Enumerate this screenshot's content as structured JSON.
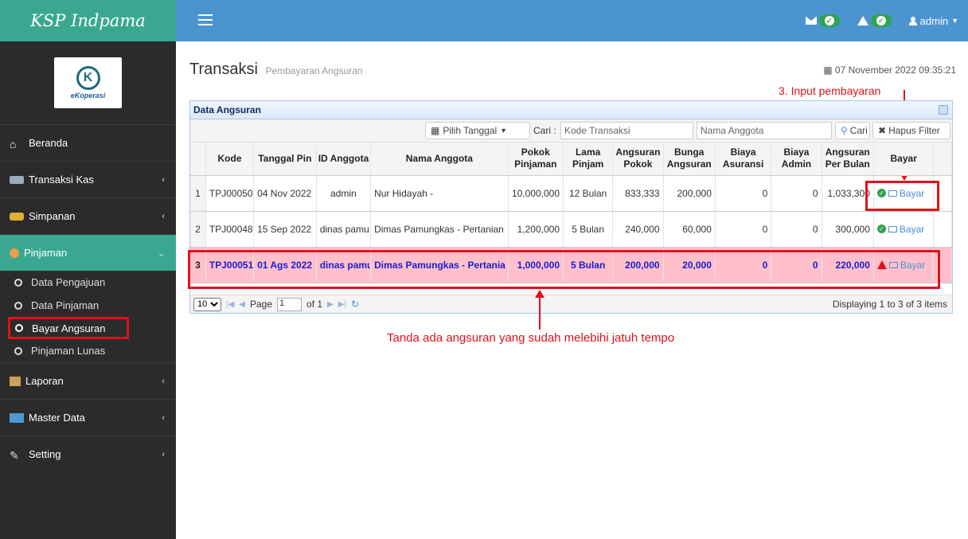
{
  "brand": "KSP Indpama",
  "top": {
    "user": "admin"
  },
  "logo": {
    "text": "eKoperasi"
  },
  "sidebar": {
    "items": [
      {
        "label": "Beranda"
      },
      {
        "label": "Transaksi Kas"
      },
      {
        "label": "Simpanan"
      },
      {
        "label": "Pinjaman"
      },
      {
        "label": "Laporan"
      },
      {
        "label": "Master Data"
      },
      {
        "label": "Setting"
      }
    ],
    "sub": [
      {
        "label": "Data Pengajuan"
      },
      {
        "label": "Data Pinjaman"
      },
      {
        "label": "Bayar Angsuran"
      },
      {
        "label": "Pinjaman Lunas"
      }
    ]
  },
  "page": {
    "title": "Transaksi",
    "subtitle": "Pembayaran Angsuran",
    "datetime": "07 November 2022  09:35:21"
  },
  "annotations": {
    "top": "3. Input pembayaran",
    "bottom": "Tanda ada angsuran yang sudah melebihi jatuh tempo"
  },
  "panel": {
    "title": "Data Angsuran",
    "date_filter": "Pilih Tanggal",
    "cari_label": "Cari :",
    "kode_placeholder": "Kode Transaksi",
    "nama_placeholder": "Nama Anggota",
    "cari_button": "Cari",
    "hapus_button": "Hapus Filter"
  },
  "table": {
    "headers": [
      "Kode",
      "Tanggal Pin",
      "ID Anggota",
      "Nama Anggota",
      "Pokok Pinjaman",
      "Lama Pinjam",
      "Angsuran Pokok",
      "Bunga Angsuran",
      "Biaya Asuransi",
      "Biaya Admin",
      "Angsuran Per Bulan",
      "Bayar"
    ],
    "rows": [
      {
        "no": "1",
        "kode": "TPJ00050",
        "tanggal": "04 Nov 2022",
        "id": "admin",
        "nama": "Nur Hidayah -",
        "pokok": "10,000,000",
        "lama": "12 Bulan",
        "angsuran_pokok": "833,333",
        "bunga": "200,000",
        "asuransi": "0",
        "admin": "0",
        "per_bulan": "1,033,300",
        "bayar": "Bayar"
      },
      {
        "no": "2",
        "kode": "TPJ00048",
        "tanggal": "15 Sep 2022",
        "id": "dinas pamu",
        "nama": "Dimas Pamungkas - Pertanian",
        "pokok": "1,200,000",
        "lama": "5 Bulan",
        "angsuran_pokok": "240,000",
        "bunga": "60,000",
        "asuransi": "0",
        "admin": "0",
        "per_bulan": "300,000",
        "bayar": "Bayar"
      },
      {
        "no": "3",
        "kode": "TPJ00051",
        "tanggal": "01 Ags 2022",
        "id": "dinas pamu",
        "nama": "Dimas Pamungkas - Pertania",
        "pokok": "1,000,000",
        "lama": "5 Bulan",
        "angsuran_pokok": "200,000",
        "bunga": "20,000",
        "asuransi": "0",
        "admin": "0",
        "per_bulan": "220,000",
        "bayar": "Bayar"
      }
    ]
  },
  "pager": {
    "page_size": "10",
    "page_label": "Page",
    "page_value": "1",
    "of": "of 1",
    "displaying": "Displaying 1 to 3 of 3 items"
  }
}
